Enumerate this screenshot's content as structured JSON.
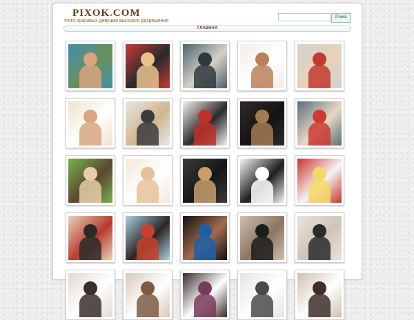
{
  "header": {
    "logo_main": "PIXOK",
    "logo_dot": ".",
    "logo_tld": "COM",
    "tagline": "Фото красивых девушек высокого разрешения"
  },
  "search": {
    "placeholder": "",
    "button_label": "Поиск"
  },
  "nav": {
    "home_label": "ГЛАВНАЯ"
  },
  "gallery": {
    "thumbs": [
      {
        "bg": [
          "#3f8fb0",
          "#d9a47e",
          "#6b8f5a"
        ]
      },
      {
        "bg": [
          "#c83a3a",
          "#e9c28f",
          "#2a2a2a"
        ]
      },
      {
        "bg": [
          "#4a6470",
          "#2f3a40",
          "#d7d0c4"
        ]
      },
      {
        "bg": [
          "#f2ece6",
          "#b9805a",
          "#ffffff"
        ]
      },
      {
        "bg": [
          "#d2d2d2",
          "#c23b2f",
          "#e6d3b8"
        ]
      },
      {
        "bg": [
          "#f1e1cf",
          "#d7a77f",
          "#ffffff"
        ]
      },
      {
        "bg": [
          "#e8e8e8",
          "#3b3b3b",
          "#d1b58e"
        ]
      },
      {
        "bg": [
          "#f4f0ec",
          "#c0302a",
          "#2b2b2b"
        ]
      },
      {
        "bg": [
          "#2f2a28",
          "#a57a52",
          "#141414"
        ]
      },
      {
        "bg": [
          "#5a6e7c",
          "#cd3a36",
          "#e8d8c2"
        ]
      },
      {
        "bg": [
          "#7bb14e",
          "#e8cda9",
          "#5a4630"
        ]
      },
      {
        "bg": [
          "#f3e8dc",
          "#e4c398",
          "#ffffff"
        ]
      },
      {
        "bg": [
          "#3a3a3a",
          "#c99f6c",
          "#171717"
        ]
      },
      {
        "bg": [
          "#f5f5f5",
          "#ffffff",
          "#1e1e1e"
        ]
      },
      {
        "bg": [
          "#c8332f",
          "#f3d86a",
          "#f4f4f4"
        ]
      },
      {
        "bg": [
          "#e6d2bc",
          "#2a2a2a",
          "#b83a2e"
        ]
      },
      {
        "bg": [
          "#a9cfe3",
          "#c7412e",
          "#2b2522"
        ]
      },
      {
        "bg": [
          "#111111",
          "#1f5fa8",
          "#a26b4e"
        ]
      },
      {
        "bg": [
          "#cfbfae",
          "#1c1c1c",
          "#8a7562"
        ]
      },
      {
        "bg": [
          "#e9e3dc",
          "#2b2b2b",
          "#cfc4b8"
        ]
      },
      {
        "bg": [
          "#e0d9d2",
          "#3a2e2a",
          "#ffffff"
        ]
      },
      {
        "bg": [
          "#d8c8b8",
          "#7c5a44",
          "#ffffff"
        ]
      },
      {
        "bg": [
          "#3b2a2a",
          "#7a3a5a",
          "#ffffff"
        ]
      },
      {
        "bg": [
          "#e5e5e5",
          "#4a4a4a",
          "#ffffff"
        ]
      },
      {
        "bg": [
          "#d0c0b0",
          "#3f2f2a",
          "#ffffff"
        ]
      }
    ]
  }
}
